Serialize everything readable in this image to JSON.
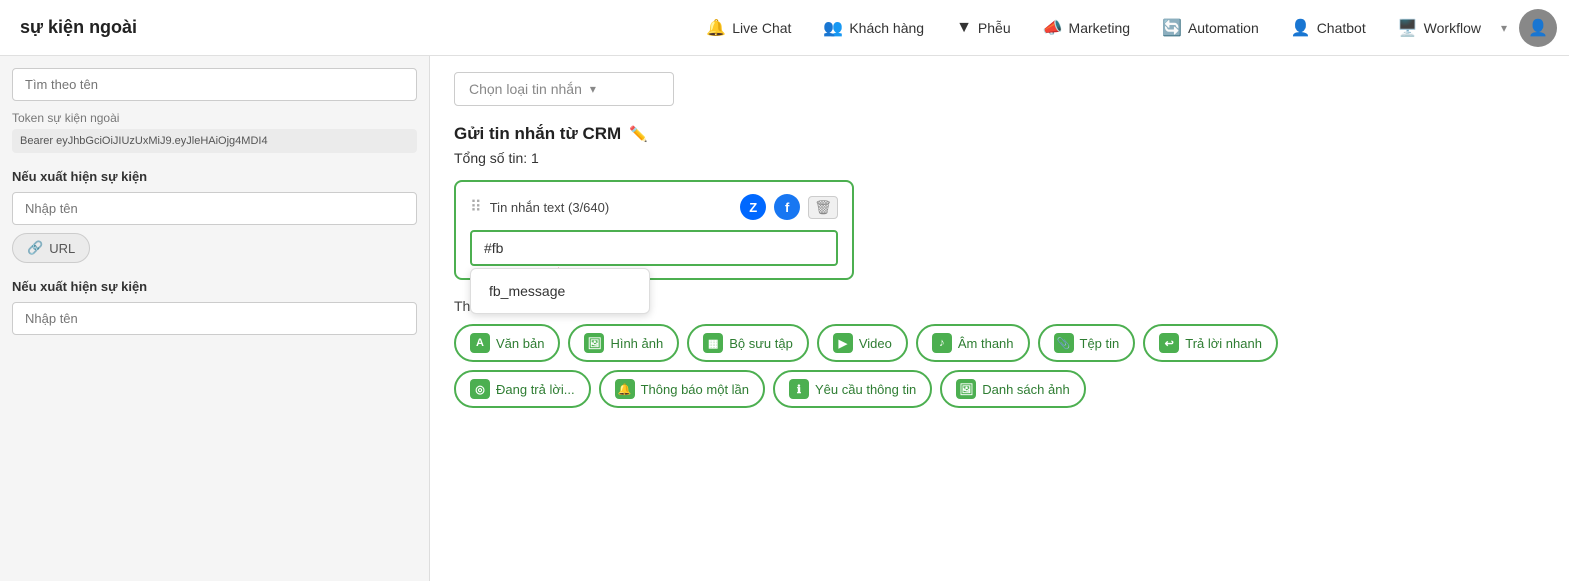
{
  "nav": {
    "title": "sự kiện ngoài",
    "items": [
      {
        "id": "live-chat",
        "label": "Live Chat",
        "icon": "🔔"
      },
      {
        "id": "khach-hang",
        "label": "Khách hàng",
        "icon": "👥"
      },
      {
        "id": "pheu",
        "label": "Phễu",
        "icon": "▼"
      },
      {
        "id": "marketing",
        "label": "Marketing",
        "icon": "📣"
      },
      {
        "id": "automation",
        "label": "Automation",
        "icon": "🔄"
      },
      {
        "id": "chatbot",
        "label": "Chatbot",
        "icon": "👤"
      },
      {
        "id": "workflow",
        "label": "Workflow",
        "icon": "🖥️"
      }
    ],
    "arrow_label": "▾"
  },
  "sidebar": {
    "search_placeholder": "Tìm theo tên",
    "token_label": "Token sự kiện ngoài",
    "token_value": "Bearer eyJhbGciOiJIUzUxMiJ9.eyJleHAiOjg4MDI4",
    "section1": {
      "title": "Nếu xuất hiện sự kiện",
      "input_placeholder": "Nhập tên",
      "url_label": "URL"
    },
    "section2": {
      "title": "Nếu xuất hiện sự kiện",
      "input_placeholder": "Nhập tên"
    }
  },
  "main": {
    "choose_type_placeholder": "Chọn loại tin nhắn",
    "section_title": "Gửi tin nhắn từ CRM",
    "total_tin": "Tổng số tin: 1",
    "message_card": {
      "title": "Tin nhắn text (3/640)",
      "channel_zalo": "Z",
      "channel_fb": "f",
      "input_value": "#fb",
      "autocomplete_item": "fb_message"
    },
    "them_noi_dung": "Thêm nội dung",
    "action_buttons_row1": [
      {
        "id": "van-ban",
        "icon": "A",
        "label": "Văn bản"
      },
      {
        "id": "hinh-anh",
        "icon": "🖼",
        "label": "Hình ảnh"
      },
      {
        "id": "bo-suu-tap",
        "icon": "📋",
        "label": "Bộ sưu tập"
      },
      {
        "id": "video",
        "icon": "▶",
        "label": "Video"
      },
      {
        "id": "am-thanh",
        "icon": "🔊",
        "label": "Âm thanh"
      },
      {
        "id": "tep-tin",
        "icon": "📎",
        "label": "Tệp tin"
      },
      {
        "id": "tra-loi-nhanh",
        "icon": "↩",
        "label": "Trả lời nhanh"
      }
    ],
    "action_buttons_row2": [
      {
        "id": "dang-tra-loi",
        "icon": "◎",
        "label": "Đang trả lời..."
      },
      {
        "id": "thong-bao-mot-lan",
        "icon": "🔔",
        "label": "Thông báo một lần"
      },
      {
        "id": "yeu-cau-thong-tin",
        "icon": "ℹ",
        "label": "Yêu cầu thông tin"
      },
      {
        "id": "danh-sach-anh",
        "icon": "🖼",
        "label": "Danh sách ảnh"
      }
    ]
  }
}
